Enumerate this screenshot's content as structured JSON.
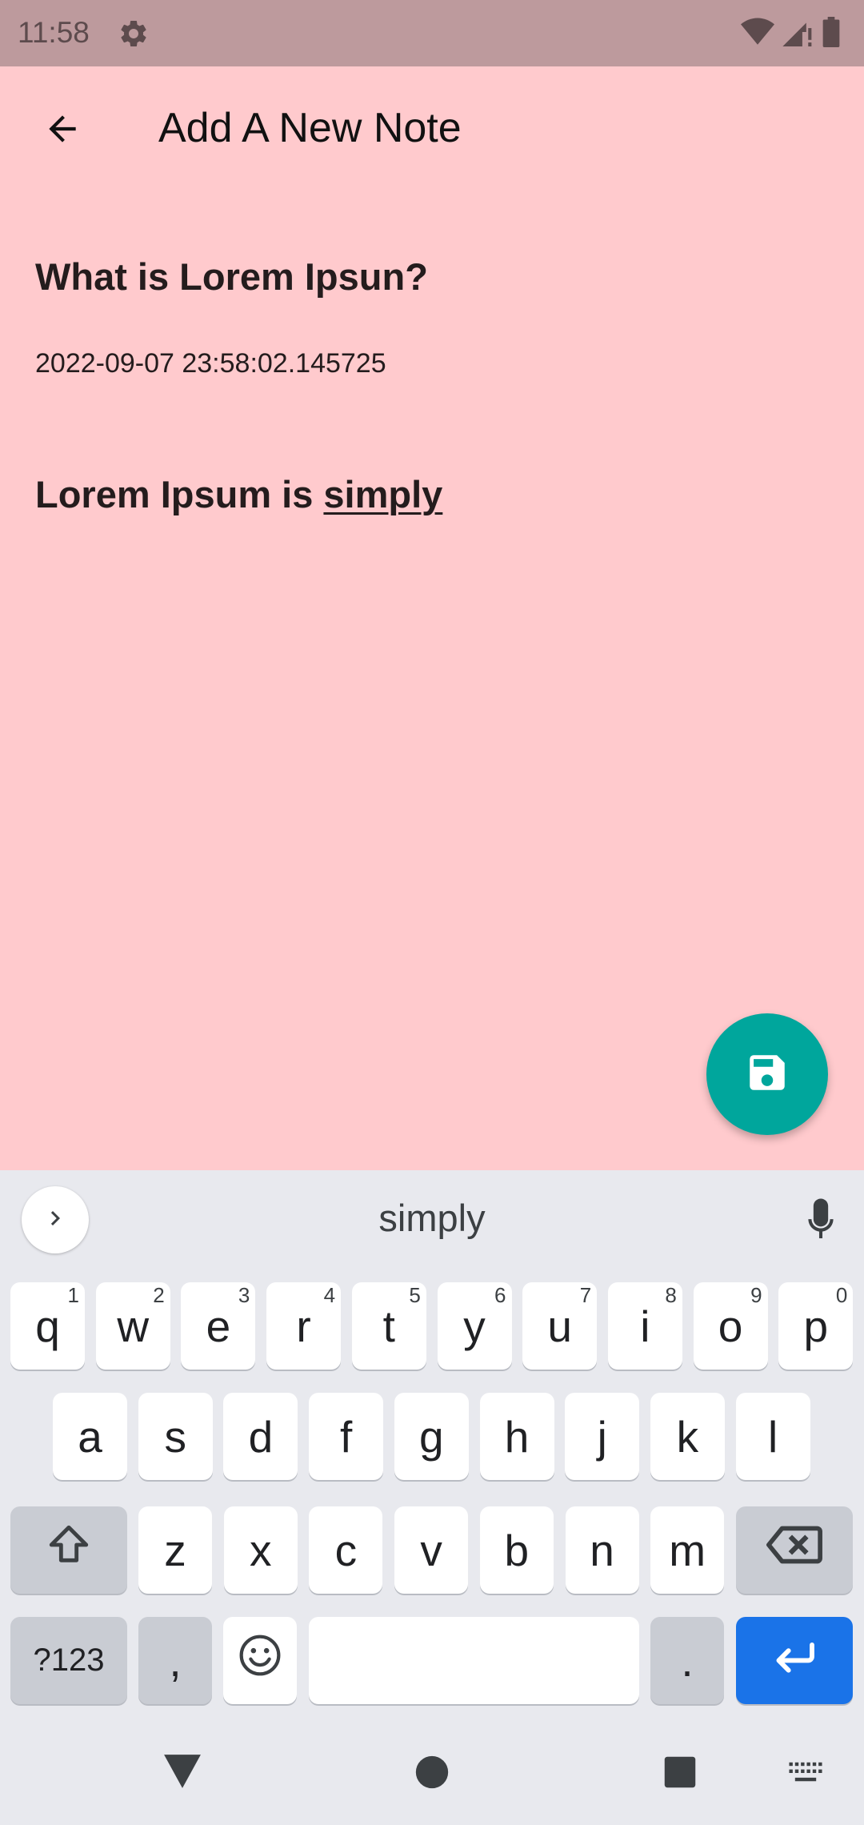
{
  "status_bar": {
    "time": "11:58"
  },
  "app_bar": {
    "title": "Add A New Note"
  },
  "note": {
    "title": "What is Lorem Ipsun?",
    "date": "2022-09-07 23:58:02.145725",
    "body_prefix": "Lorem Ipsum is ",
    "body_composing": "simply"
  },
  "keyboard": {
    "suggestion": "simply",
    "row1": [
      {
        "label": "q",
        "hint": "1"
      },
      {
        "label": "w",
        "hint": "2"
      },
      {
        "label": "e",
        "hint": "3"
      },
      {
        "label": "r",
        "hint": "4"
      },
      {
        "label": "t",
        "hint": "5"
      },
      {
        "label": "y",
        "hint": "6"
      },
      {
        "label": "u",
        "hint": "7"
      },
      {
        "label": "i",
        "hint": "8"
      },
      {
        "label": "o",
        "hint": "9"
      },
      {
        "label": "p",
        "hint": "0"
      }
    ],
    "row2": [
      "a",
      "s",
      "d",
      "f",
      "g",
      "h",
      "j",
      "k",
      "l"
    ],
    "row3": [
      "z",
      "x",
      "c",
      "v",
      "b",
      "n",
      "m"
    ],
    "symbols_label": "?123",
    "comma_label": ",",
    "period_label": "."
  },
  "colors": {
    "background": "#ffcacd",
    "status_bar": "#bd9a9d",
    "fab": "#00a69c",
    "enter_key": "#1a73e8"
  }
}
